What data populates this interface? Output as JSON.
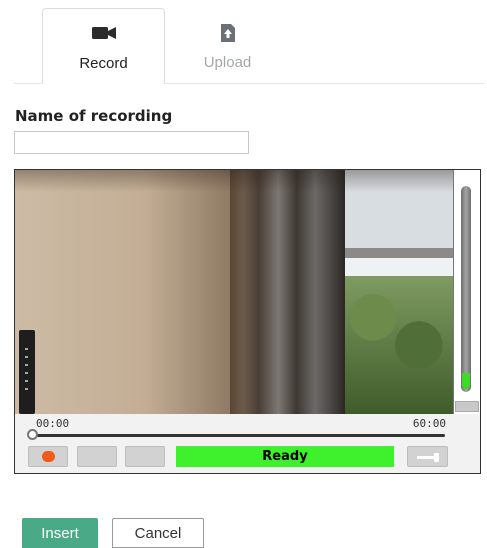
{
  "tabs": [
    {
      "label": "Record",
      "icon": "video-camera-icon",
      "active": true
    },
    {
      "label": "Upload",
      "icon": "upload-icon",
      "active": false
    }
  ],
  "form": {
    "name_label": "Name of recording",
    "name_value": ""
  },
  "recorder": {
    "time_start": "00:00",
    "time_end": "60:00",
    "progress": 0,
    "status": "Ready",
    "status_color": "#3ff02c",
    "record_color": "#f25a1a",
    "level_meter": 0.08
  },
  "actions": {
    "insert_label": "Insert",
    "cancel_label": "Cancel",
    "insert_color": "#4aaa87"
  }
}
